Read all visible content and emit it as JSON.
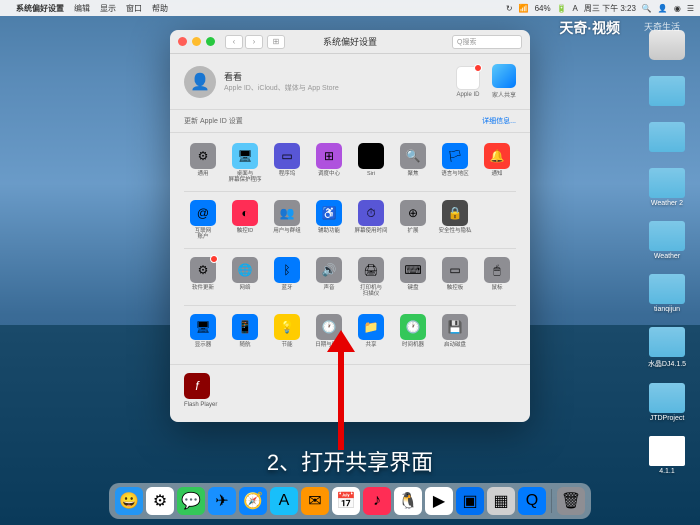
{
  "menubar": {
    "app": "系统偏好设置",
    "items": [
      "编辑",
      "显示",
      "窗口",
      "帮助"
    ],
    "battery": "64%",
    "date": "周三 下午 3:23"
  },
  "watermark": "天奇·视频",
  "watermark2": "天奇生活",
  "desktop": [
    {
      "label": "",
      "type": "disk"
    },
    {
      "label": "",
      "type": "folder"
    },
    {
      "label": "",
      "type": "folder"
    },
    {
      "label": "Weather 2",
      "type": "folder"
    },
    {
      "label": "Weather",
      "type": "folder"
    },
    {
      "label": "tianqijun",
      "type": "folder"
    },
    {
      "label": "水晶DJ4.1.5",
      "type": "folder"
    },
    {
      "label": "JTDProject",
      "type": "folder"
    },
    {
      "label": "4.1.1",
      "type": "file"
    }
  ],
  "prefs": {
    "title": "系统偏好设置",
    "search_ph": "Q搜索",
    "account": {
      "name": "看看",
      "sub": "Apple ID、iCloud、媒体与 App Store",
      "appleid": "Apple ID",
      "family": "家人共享"
    },
    "update": {
      "left": "更新 Apple ID 设置",
      "right": "详细信息..."
    },
    "rows": [
      [
        {
          "l": "通用",
          "c": "#8e8e93",
          "t": "⚙"
        },
        {
          "l": "桌面与\n屏幕保护程序",
          "c": "#5ac8fa",
          "t": "🖥"
        },
        {
          "l": "程序坞",
          "c": "#5856d6",
          "t": "▭"
        },
        {
          "l": "调度中心",
          "c": "#af52de",
          "t": "⊞"
        },
        {
          "l": "Siri",
          "c": "#000",
          "t": "◉"
        },
        {
          "l": "聚焦",
          "c": "#8e8e93",
          "t": "🔍"
        },
        {
          "l": "语言与地区",
          "c": "#007aff",
          "t": "🏳"
        },
        {
          "l": "通知",
          "c": "#ff3b30",
          "t": "🔔"
        }
      ],
      [
        {
          "l": "互联网\n账户",
          "c": "#007aff",
          "t": "@"
        },
        {
          "l": "触控ID",
          "c": "#ff2d55",
          "t": "◐"
        },
        {
          "l": "用户与群组",
          "c": "#8e8e93",
          "t": "👥"
        },
        {
          "l": "辅助功能",
          "c": "#007aff",
          "t": "♿"
        },
        {
          "l": "屏幕使用时间",
          "c": "#5856d6",
          "t": "⏱"
        },
        {
          "l": "扩展",
          "c": "#8e8e93",
          "t": "⊕"
        },
        {
          "l": "安全性与隐私",
          "c": "#4a4a4a",
          "t": "🔒"
        },
        {
          "l": "",
          "c": "",
          "t": ""
        }
      ],
      [
        {
          "l": "软件更新",
          "c": "#8e8e93",
          "t": "⚙",
          "b": 1
        },
        {
          "l": "网络",
          "c": "#8e8e93",
          "t": "🌐"
        },
        {
          "l": "蓝牙",
          "c": "#007aff",
          "t": "ᛒ"
        },
        {
          "l": "声音",
          "c": "#8e8e93",
          "t": "🔊"
        },
        {
          "l": "打印机与\n扫描仪",
          "c": "#8e8e93",
          "t": "🖨"
        },
        {
          "l": "键盘",
          "c": "#8e8e93",
          "t": "⌨"
        },
        {
          "l": "触控板",
          "c": "#8e8e93",
          "t": "▭"
        },
        {
          "l": "鼠标",
          "c": "#8e8e93",
          "t": "🖱"
        }
      ],
      [
        {
          "l": "显示器",
          "c": "#007aff",
          "t": "🖥"
        },
        {
          "l": "随航",
          "c": "#007aff",
          "t": "📱"
        },
        {
          "l": "节能",
          "c": "#ffcc00",
          "t": "💡"
        },
        {
          "l": "日期与时间",
          "c": "#8e8e93",
          "t": "🕐"
        },
        {
          "l": "共享",
          "c": "#007aff",
          "t": "📁"
        },
        {
          "l": "时间机器",
          "c": "#34c759",
          "t": "🕐"
        },
        {
          "l": "启动磁盘",
          "c": "#8e8e93",
          "t": "💾"
        },
        {
          "l": "",
          "c": "",
          "t": ""
        }
      ]
    ],
    "flash": "Flash Player"
  },
  "caption": "2、打开共享界面",
  "dock": [
    {
      "c": "#2396f3",
      "t": "😀"
    },
    {
      "c": "#fff",
      "t": "⚙"
    },
    {
      "c": "#34c759",
      "t": "💬"
    },
    {
      "c": "#1890ff",
      "t": "✈"
    },
    {
      "c": "#0a84ff",
      "t": "🧭"
    },
    {
      "c": "#18bffa",
      "t": "A"
    },
    {
      "c": "#ff9500",
      "t": "✉"
    },
    {
      "c": "#fff",
      "t": "📅"
    },
    {
      "c": "#ff2d55",
      "t": "♪"
    },
    {
      "c": "#fff",
      "t": "🐧"
    },
    {
      "c": "#fff",
      "t": "▶"
    },
    {
      "c": "#0070f3",
      "t": "▣"
    },
    {
      "c": "#d0d0d0",
      "t": "▦"
    },
    {
      "c": "#007aff",
      "t": "Q"
    },
    {
      "c": "#8e8e93",
      "t": "🗑"
    }
  ]
}
